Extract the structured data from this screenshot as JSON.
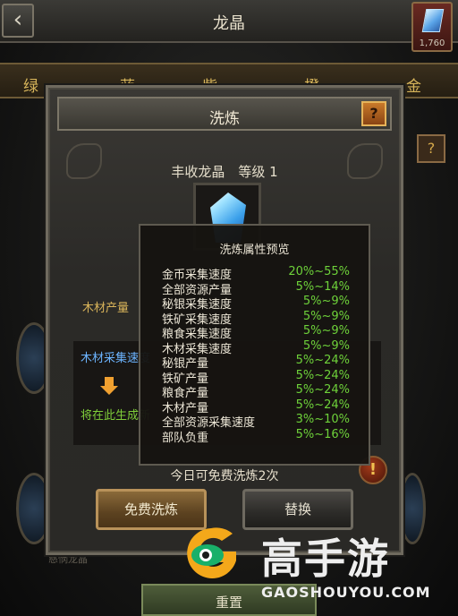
{
  "screen": {
    "title": "龙晶",
    "gem_count": "1,760",
    "tabs": [
      "绿",
      "蓝",
      "紫",
      "橙",
      "金"
    ],
    "side_help": "?",
    "bottom_button": "重置",
    "bottom_faint_text": "慈悯龙晶"
  },
  "modal": {
    "title": "洗炼",
    "help": "?",
    "item_title": "丰收龙晶　等级 1",
    "current_stat_label": "木材产量",
    "reforge_stat": "木材采集速度",
    "generate_hint": "将在此生成新",
    "free_count": "今日可免费洗炼2次",
    "warn": "!",
    "buttons": {
      "free_reforge": "免费洗炼",
      "replace": "替换"
    }
  },
  "preview": {
    "title": "洗炼属性预览",
    "rows": [
      {
        "name": "金币采集速度",
        "range": "20%~55%"
      },
      {
        "name": "全部资源产量",
        "range": "5%~14%"
      },
      {
        "name": "秘银采集速度",
        "range": "5%~9%"
      },
      {
        "name": "铁矿采集速度",
        "range": "5%~9%"
      },
      {
        "name": "粮食采集速度",
        "range": "5%~9%"
      },
      {
        "name": "木材采集速度",
        "range": "5%~9%"
      },
      {
        "name": "秘银产量",
        "range": "5%~24%"
      },
      {
        "name": "铁矿产量",
        "range": "5%~24%"
      },
      {
        "name": "粮食产量",
        "range": "5%~24%"
      },
      {
        "name": "木材产量",
        "range": "5%~24%"
      },
      {
        "name": "全部资源采集速度",
        "range": "3%~10%"
      },
      {
        "name": "部队负重",
        "range": "5%~16%"
      }
    ]
  },
  "colors": {
    "range_green": "#6ed23a",
    "gold_label": "#d9b45a",
    "blue_stat": "#6cb4ff"
  },
  "watermark": {
    "brand": "高手游",
    "url": "GAOSHOUYOU.COM"
  }
}
